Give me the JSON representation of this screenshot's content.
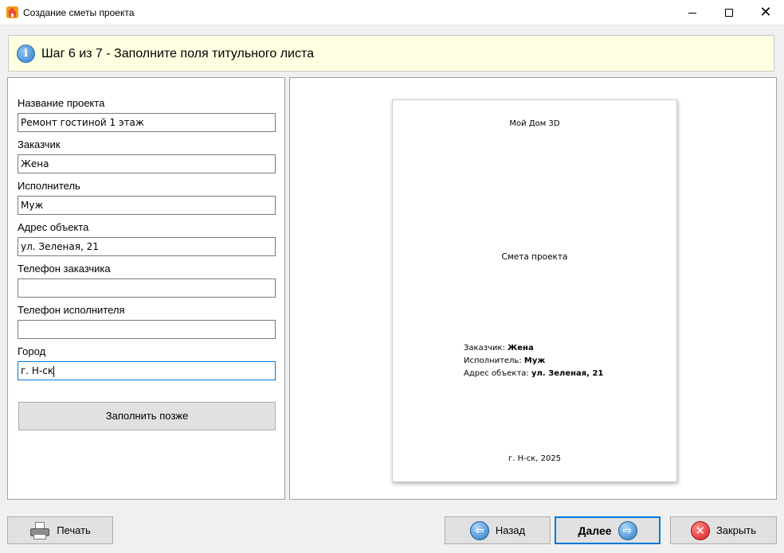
{
  "window": {
    "title": "Создание сметы проекта"
  },
  "banner": {
    "text": "Шаг 6 из 7 - Заполните поля титульного листа",
    "icon": "info-icon"
  },
  "form": {
    "fields": [
      {
        "label": "Название проекта",
        "value": "Ремонт гостиной 1 этаж"
      },
      {
        "label": "Заказчик",
        "value": "Жена"
      },
      {
        "label": "Исполнитель",
        "value": "Муж"
      },
      {
        "label": "Адрес объекта",
        "value": "ул. Зеленая, 21"
      },
      {
        "label": "Телефон заказчика",
        "value": ""
      },
      {
        "label": "Телефон исполнителя",
        "value": ""
      },
      {
        "label": "Город",
        "value": "г. Н-ск"
      }
    ],
    "fill_later_label": "Заполнить позже"
  },
  "preview": {
    "company": "Мой Дом 3D",
    "title": "Смета проекта",
    "customer_label": "Заказчик:",
    "customer_value": "Жена",
    "contractor_label": "Исполнитель:",
    "contractor_value": "Муж",
    "address_label": "Адрес объекта:",
    "address_value": "ул. Зеленая, 21",
    "footer": "г. Н-ск, 2025"
  },
  "buttons": {
    "print": "Печать",
    "back": "Назад",
    "next": "Далее",
    "close": "Закрыть"
  },
  "colors": {
    "banner_bg": "#ffffe1",
    "accent": "#0078d7"
  }
}
